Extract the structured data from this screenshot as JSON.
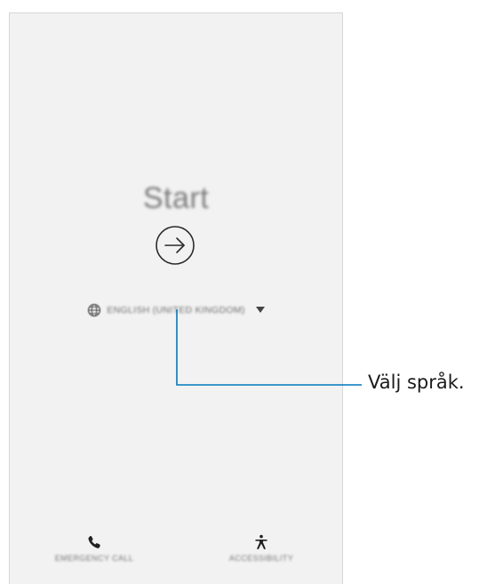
{
  "screen": {
    "title": "Start",
    "language": {
      "label": "ENGLISH (UNITED KINGDOM)",
      "icon": "globe-icon"
    },
    "next_button_icon": "arrow-right-circle-icon",
    "bottom": {
      "emergency_label": "EMERGENCY CALL",
      "emergency_icon": "phone-icon",
      "accessibility_label": "ACCESSIBILITY",
      "accessibility_icon": "accessibility-icon"
    }
  },
  "callout": {
    "text": "Välj språk.",
    "line_color": "#0077c0"
  },
  "colors": {
    "screen_background": "#f2f2f2",
    "text_blurred": "#7a7a7a"
  }
}
